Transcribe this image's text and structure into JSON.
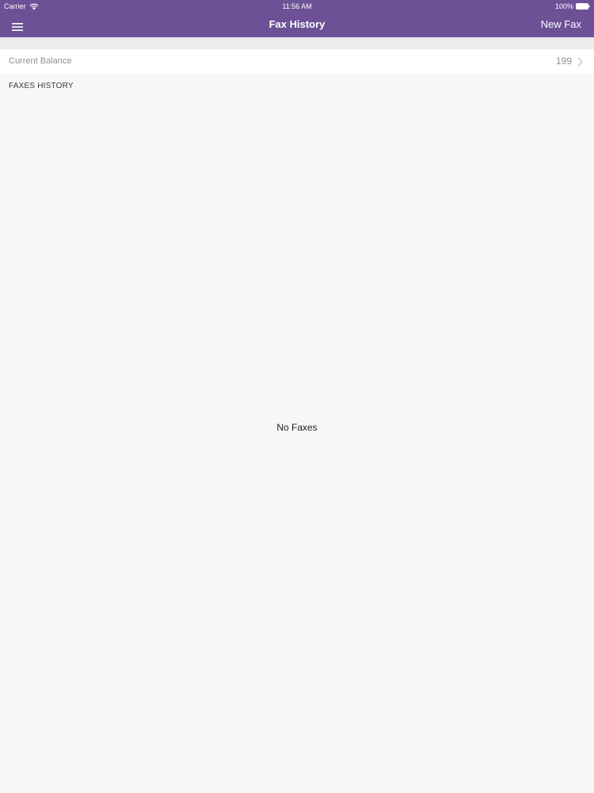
{
  "status_bar": {
    "carrier": "Carrier",
    "time": "11:56 AM",
    "battery": "100%",
    "icons": {
      "wifi": "wifi-icon",
      "battery": "battery-icon"
    }
  },
  "nav": {
    "title": "Fax History",
    "new_fax_label": "New Fax",
    "menu_icon": "hamburger-menu-icon"
  },
  "balance": {
    "label": "Current Balance",
    "value": "199",
    "chevron_icon": "chevron-right-icon"
  },
  "history": {
    "section_title": "FAXES HISTORY",
    "empty_text": "No Faxes"
  },
  "colors": {
    "accent": "#6c5197",
    "background": "#f7f6f8",
    "band": "#ececee",
    "row": "#ffffff",
    "muted_text": "#8f8f93"
  }
}
